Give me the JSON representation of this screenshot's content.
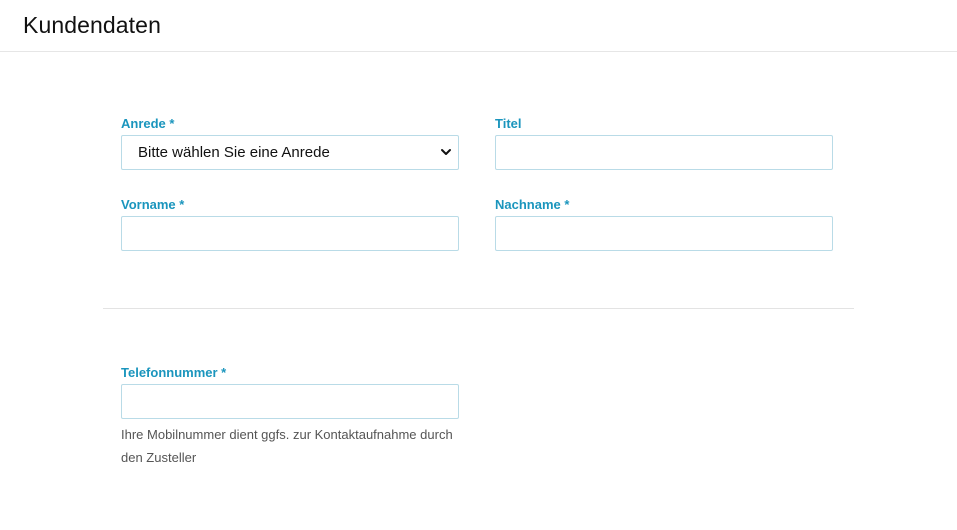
{
  "header": {
    "title": "Kundendaten"
  },
  "form": {
    "anrede": {
      "label": "Anrede *",
      "selected": "Bitte wählen Sie eine Anrede"
    },
    "titel": {
      "label": "Titel",
      "value": ""
    },
    "vorname": {
      "label": "Vorname *",
      "value": ""
    },
    "nachname": {
      "label": "Nachname *",
      "value": ""
    },
    "telefon": {
      "label": "Telefonnummer *",
      "value": "",
      "help": "Ihre Mobilnummer dient ggfs. zur Kontaktaufnahme durch den Zusteller"
    }
  },
  "colors": {
    "label": "#1a95bd",
    "input_border": "#b9dbe7",
    "divider": "#e3e3e3"
  },
  "icons": {
    "select_arrow": "chevron-down-icon"
  }
}
